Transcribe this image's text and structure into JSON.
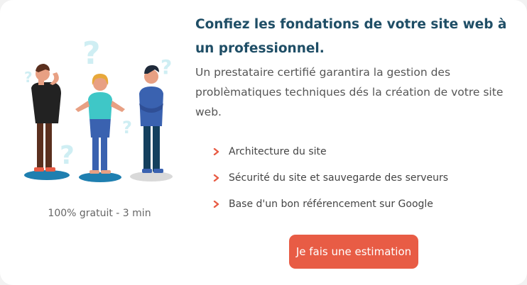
{
  "card": {
    "title": "Confiez les fondations de votre site web à un professionnel.",
    "subtitle": "Un prestataire certifié garantira la gestion des problèmatiques techniques dés la création de votre site web.",
    "features": [
      "Architecture du site",
      "Sécurité du site et sauvegarde des serveurs",
      "Base d'un bon référencement sur Google"
    ],
    "caption": "100% gratuit - 3 min",
    "cta_label": "Je fais une estimation"
  },
  "icons": {
    "bullet": "chevron-right-icon",
    "illustration": "confused-people-illustration"
  },
  "colors": {
    "title": "#1f4e66",
    "accent": "#e85c45",
    "text": "#555555",
    "background": "#f2f2f2"
  }
}
